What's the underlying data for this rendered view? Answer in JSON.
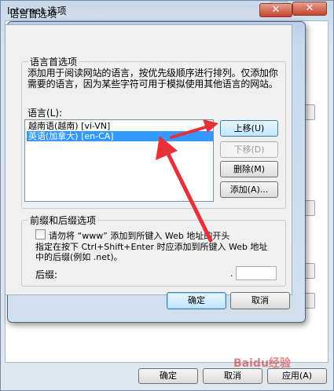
{
  "outer_window": {
    "title": "Internet 选项",
    "help_label": "?",
    "close_label": "✕",
    "buttons": {
      "ok": "确定",
      "cancel": "取消",
      "apply": "应用(A)"
    }
  },
  "dialog": {
    "title": "语言首选项",
    "close_label": "✕",
    "language_group": {
      "legend": "语言首选项",
      "description": "添加用于阅读网站的语言，按优先级顺序进行排列。仅添加你需要的语言，因为某些字符可用于模拟使用其他语言的网站。",
      "list_label": "语言(L):",
      "languages": [
        {
          "label": "越南语(越南) [vi-VN]",
          "selected": false
        },
        {
          "label": "英语(加拿大) [en-CA]",
          "selected": true
        }
      ],
      "buttons": {
        "move_up": "上移(U)",
        "move_down": "下移(D)",
        "remove": "删除(M)",
        "add": "添加(A)..."
      }
    },
    "prefix_group": {
      "legend": "前缀和后缀选项",
      "checkbox_label": "请勿将 “www” 添加到所键入 Web 地址的开头",
      "checkbox_checked": false,
      "instruction": "指定在按下 Ctrl+Shift+Enter 时应添加到所键入 Web 地址中的后缀(例如 .net)。",
      "suffix_label": "后缀:",
      "suffix_dot": ".",
      "suffix_value": ""
    },
    "ok_label": "确定",
    "cancel_label": "取消"
  },
  "annotations": {
    "arrow_color": "#e8303a"
  },
  "watermark": "Baidu经验"
}
